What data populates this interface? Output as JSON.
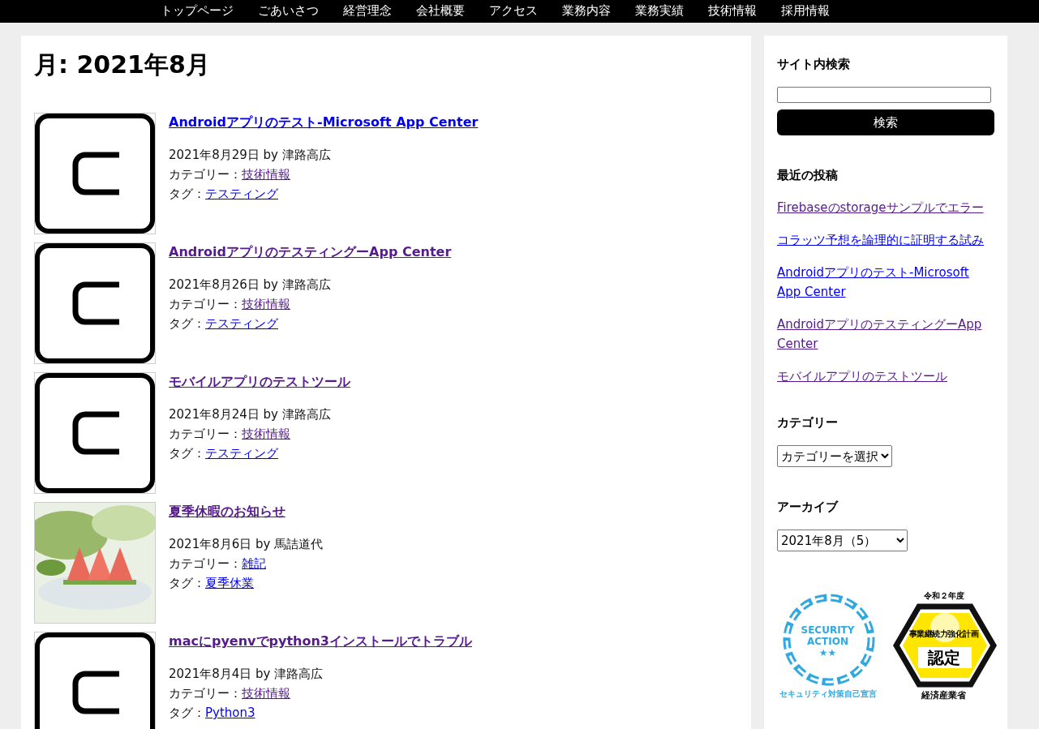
{
  "nav": [
    "トップページ",
    "ごあいさつ",
    "経営理念",
    "会社概要",
    "アクセス",
    "業務内容",
    "業務実績",
    "技術情報",
    "採用情報"
  ],
  "archive_title": "月: 2021年8月",
  "posts": [
    {
      "thumb": {
        "kind": "logo"
      },
      "title": "Androidアプリのテスト-Microsoft App Center",
      "title_visited": false,
      "date": "2021年8月29日",
      "by": "by",
      "author": "津路高広",
      "category_label": "カテゴリー：",
      "category": "技術情報",
      "category_visited": true,
      "tag_label": "タグ：",
      "tag": "テスティング",
      "tag_visited": false
    },
    {
      "thumb": {
        "kind": "logo"
      },
      "title": "AndroidアプリのテスティングーApp Center",
      "title_visited": true,
      "date": "2021年8月26日",
      "by": "by",
      "author": "津路高広",
      "category_label": "カテゴリー：",
      "category": "技術情報",
      "category_visited": true,
      "tag_label": "タグ：",
      "tag": "テスティング",
      "tag_visited": false
    },
    {
      "thumb": {
        "kind": "logo"
      },
      "title": "モバイルアプリのテストツール",
      "title_visited": true,
      "date": "2021年8月24日",
      "by": "by",
      "author": "津路高広",
      "category_label": "カテゴリー：",
      "category": "技術情報",
      "category_visited": true,
      "tag_label": "タグ：",
      "tag": "テスティング",
      "tag_visited": false
    },
    {
      "title": "夏季休暇のお知らせ",
      "title_visited": true,
      "date": "2021年8月6日",
      "by": "by",
      "author": "馬詰道代",
      "category_label": "カテゴリー：",
      "category": "雑記",
      "category_visited": false,
      "tag_label": "タグ：",
      "tag": "夏季休業",
      "tag_visited": false
    },
    {
      "thumb": {
        "kind": "logo"
      },
      "title": "macにpyenvでpython3インストールでトラブル",
      "title_visited": true,
      "date": "2021年8月4日",
      "by": "by",
      "author": "津路高広",
      "category_label": "カテゴリー：",
      "category": "技術情報",
      "category_visited": true,
      "tag_label": "タグ：",
      "tag": "Python3",
      "tag_visited": false
    }
  ],
  "sidebar": {
    "search": {
      "heading": "サイト内検索",
      "button": "検索"
    },
    "recent": {
      "heading": "最近の投稿",
      "items": [
        {
          "label": "Firebaseのstorageサンプルでエラー",
          "visited": true
        },
        {
          "label": "コラッツ予想を論理的に証明する試み",
          "visited": false
        },
        {
          "label": "Androidアプリのテスト-Microsoft App Center",
          "visited": false
        },
        {
          "label": "AndroidアプリのテスティングーApp Center",
          "visited": true
        },
        {
          "label": "モバイルアプリのテストツール",
          "visited": true
        }
      ]
    },
    "categories": {
      "heading": "カテゴリー",
      "select": "カテゴリーを選択"
    },
    "archives": {
      "heading": "アーカイブ",
      "select": "2021年8月（5）"
    },
    "badges": {
      "security": {
        "line1": "SECURITY",
        "line2": "ACTION",
        "stars": "★★",
        "caption": "セキュリティ対策自己宣言"
      },
      "certified": {
        "year": "令和２年度",
        "arc": "事業継続力強化計画",
        "main": "認定",
        "ministry": "経済産業省"
      }
    }
  }
}
